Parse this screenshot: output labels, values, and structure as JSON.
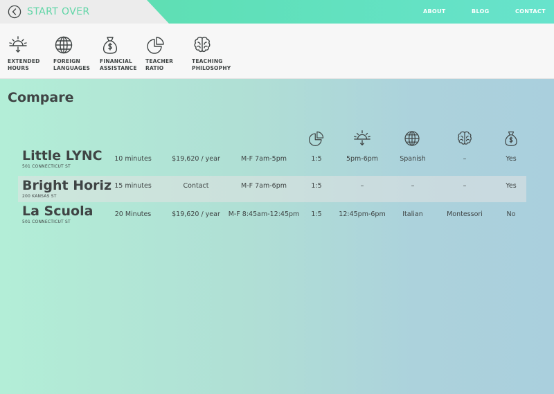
{
  "header": {
    "start_over_label": "START OVER",
    "nav": {
      "about": "ABOUT",
      "blog": "BLOG",
      "contact": "CONTACT"
    }
  },
  "filters": [
    {
      "icon": "sunrise-icon",
      "label": "EXTENDED HOURS"
    },
    {
      "icon": "globe-icon",
      "label": "FOREIGN LANGUAGES"
    },
    {
      "icon": "money-bag-icon",
      "label": "FINANCIAL ASSISTANCE"
    },
    {
      "icon": "pie-chart-icon",
      "label": "TEACHER RATIO"
    },
    {
      "icon": "brain-icon",
      "label": "TEACHING PHILOSOPHY"
    }
  ],
  "compare": {
    "title": "Compare",
    "column_icons": [
      "pie-chart-icon",
      "sunrise-icon",
      "globe-icon",
      "brain-icon",
      "money-bag-icon"
    ],
    "rows": [
      {
        "name": "Little LYNC",
        "address": "501 CONNECTICUT ST",
        "distance": "10 minutes",
        "cost": "$19,620 / year",
        "schedule": "M-F 7am-5pm",
        "ratio": "1:5",
        "extended_hours": "5pm-6pm",
        "language": "Spanish",
        "philosophy": "–",
        "financial_assistance": "Yes",
        "highlighted": false
      },
      {
        "name": "Bright Horiz",
        "address": "200 KANSAS ST",
        "distance": "15 minutes",
        "cost": "Contact",
        "schedule": "M-F 7am-6pm",
        "ratio": "1:5",
        "extended_hours": "–",
        "language": "–",
        "philosophy": "–",
        "financial_assistance": "Yes",
        "highlighted": true
      },
      {
        "name": "La Scuola",
        "address": "501 CONNECTICUT ST",
        "distance": "20 Minutes",
        "cost": "$19,620 / year",
        "schedule": "M-F 8:45am-12:45pm",
        "ratio": "1:5",
        "extended_hours": "12:45pm-6pm",
        "language": "Italian",
        "philosophy": "Montessori",
        "financial_assistance": "No",
        "highlighted": false
      }
    ]
  },
  "colors": {
    "accent": "#5fd5a6",
    "text": "#3f4444",
    "topbar": "#5fe0b8"
  }
}
